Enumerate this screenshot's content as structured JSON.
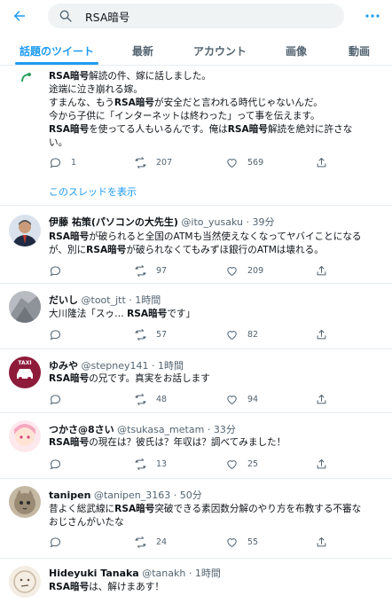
{
  "header": {
    "search_query": "RSA暗号"
  },
  "tabs": [
    "話題のツイート",
    "最新",
    "アカウント",
    "画像",
    "動画"
  ],
  "colors": {
    "accent": "#1d9bf0",
    "text": "#0f1419",
    "muted": "#536471",
    "border": "#e6ecf0"
  },
  "tweets": [
    {
      "lines": [
        [
          [
            "RSA暗号",
            true
          ],
          [
            "解読の件、嫁に話しました。",
            false
          ]
        ],
        [
          [
            "途端に泣き崩れる嫁。",
            false
          ]
        ],
        [
          [
            "すまんな、もう",
            false
          ],
          [
            "RSA暗号",
            true
          ],
          [
            "が安全だと言われる時代じゃないんだ。",
            false
          ]
        ],
        [
          [
            "今から子供に「インターネットは終わった」って事を伝えます。",
            false
          ]
        ],
        [
          [
            "RSA暗号",
            true
          ],
          [
            "を使ってる人もいるんです。俺は",
            false
          ],
          [
            "RSA暗号",
            true
          ],
          [
            "解読を絶対に許さな",
            false
          ]
        ],
        [
          [
            "い。",
            false
          ]
        ]
      ],
      "replies": "1",
      "retweets": "207",
      "likes": "569",
      "thread_link": "このスレッドを表示"
    },
    {
      "name": "伊藤 祐策(パソコンの大先生)",
      "handle": "@ito_yusaku",
      "time": "39分",
      "lines": [
        [
          [
            "RSA暗号",
            true
          ],
          [
            "が破られると全国のATMも当然使えなくなってヤバイことになる",
            false
          ]
        ],
        [
          [
            "が、別に",
            false
          ],
          [
            "RSA暗号",
            true
          ],
          [
            "が破られなくてもみずほ銀行のATMは壊れる。",
            false
          ]
        ]
      ],
      "replies": "",
      "retweets": "97",
      "likes": "209"
    },
    {
      "name": "だいし",
      "handle": "@toot_jtt",
      "time": "1時間",
      "lines": [
        [
          [
            "大川隆法「スゥ… ",
            false
          ],
          [
            "RSA暗号",
            true
          ],
          [
            "です」",
            false
          ]
        ]
      ],
      "replies": "",
      "retweets": "57",
      "likes": "82"
    },
    {
      "name": "ゆみや",
      "handle": "@stepney141",
      "time": "1時間",
      "avatar_text": "TAXI",
      "lines": [
        [
          [
            "RSA暗号",
            true
          ],
          [
            "の兄です。真実をお話します",
            false
          ]
        ]
      ],
      "replies": "",
      "retweets": "48",
      "likes": "94"
    },
    {
      "name": "つかさ@8さい",
      "handle": "@tsukasa_metam",
      "time": "33分",
      "lines": [
        [
          [
            "RSA暗号",
            true
          ],
          [
            "の現在は？彼氏は？年収は？調べてみました！",
            false
          ]
        ]
      ],
      "replies": "",
      "retweets": "13",
      "likes": "25"
    },
    {
      "name": "tanipen",
      "handle": "@tanipen_3163",
      "time": "50分",
      "lines": [
        [
          [
            "昔よく総武線に",
            false
          ],
          [
            "RSA暗号",
            true
          ],
          [
            "突破できる素因数分解のやり方を布教する不審な",
            false
          ]
        ],
        [
          [
            "おじさんがいたな",
            false
          ]
        ]
      ],
      "replies": "",
      "retweets": "24",
      "likes": "55"
    },
    {
      "name": "Hideyuki Tanaka",
      "handle": "@tanakh",
      "time": "1時間",
      "lines": [
        [
          [
            "RSA暗号",
            true
          ],
          [
            "は、解けまあす！",
            false
          ]
        ]
      ]
    }
  ]
}
